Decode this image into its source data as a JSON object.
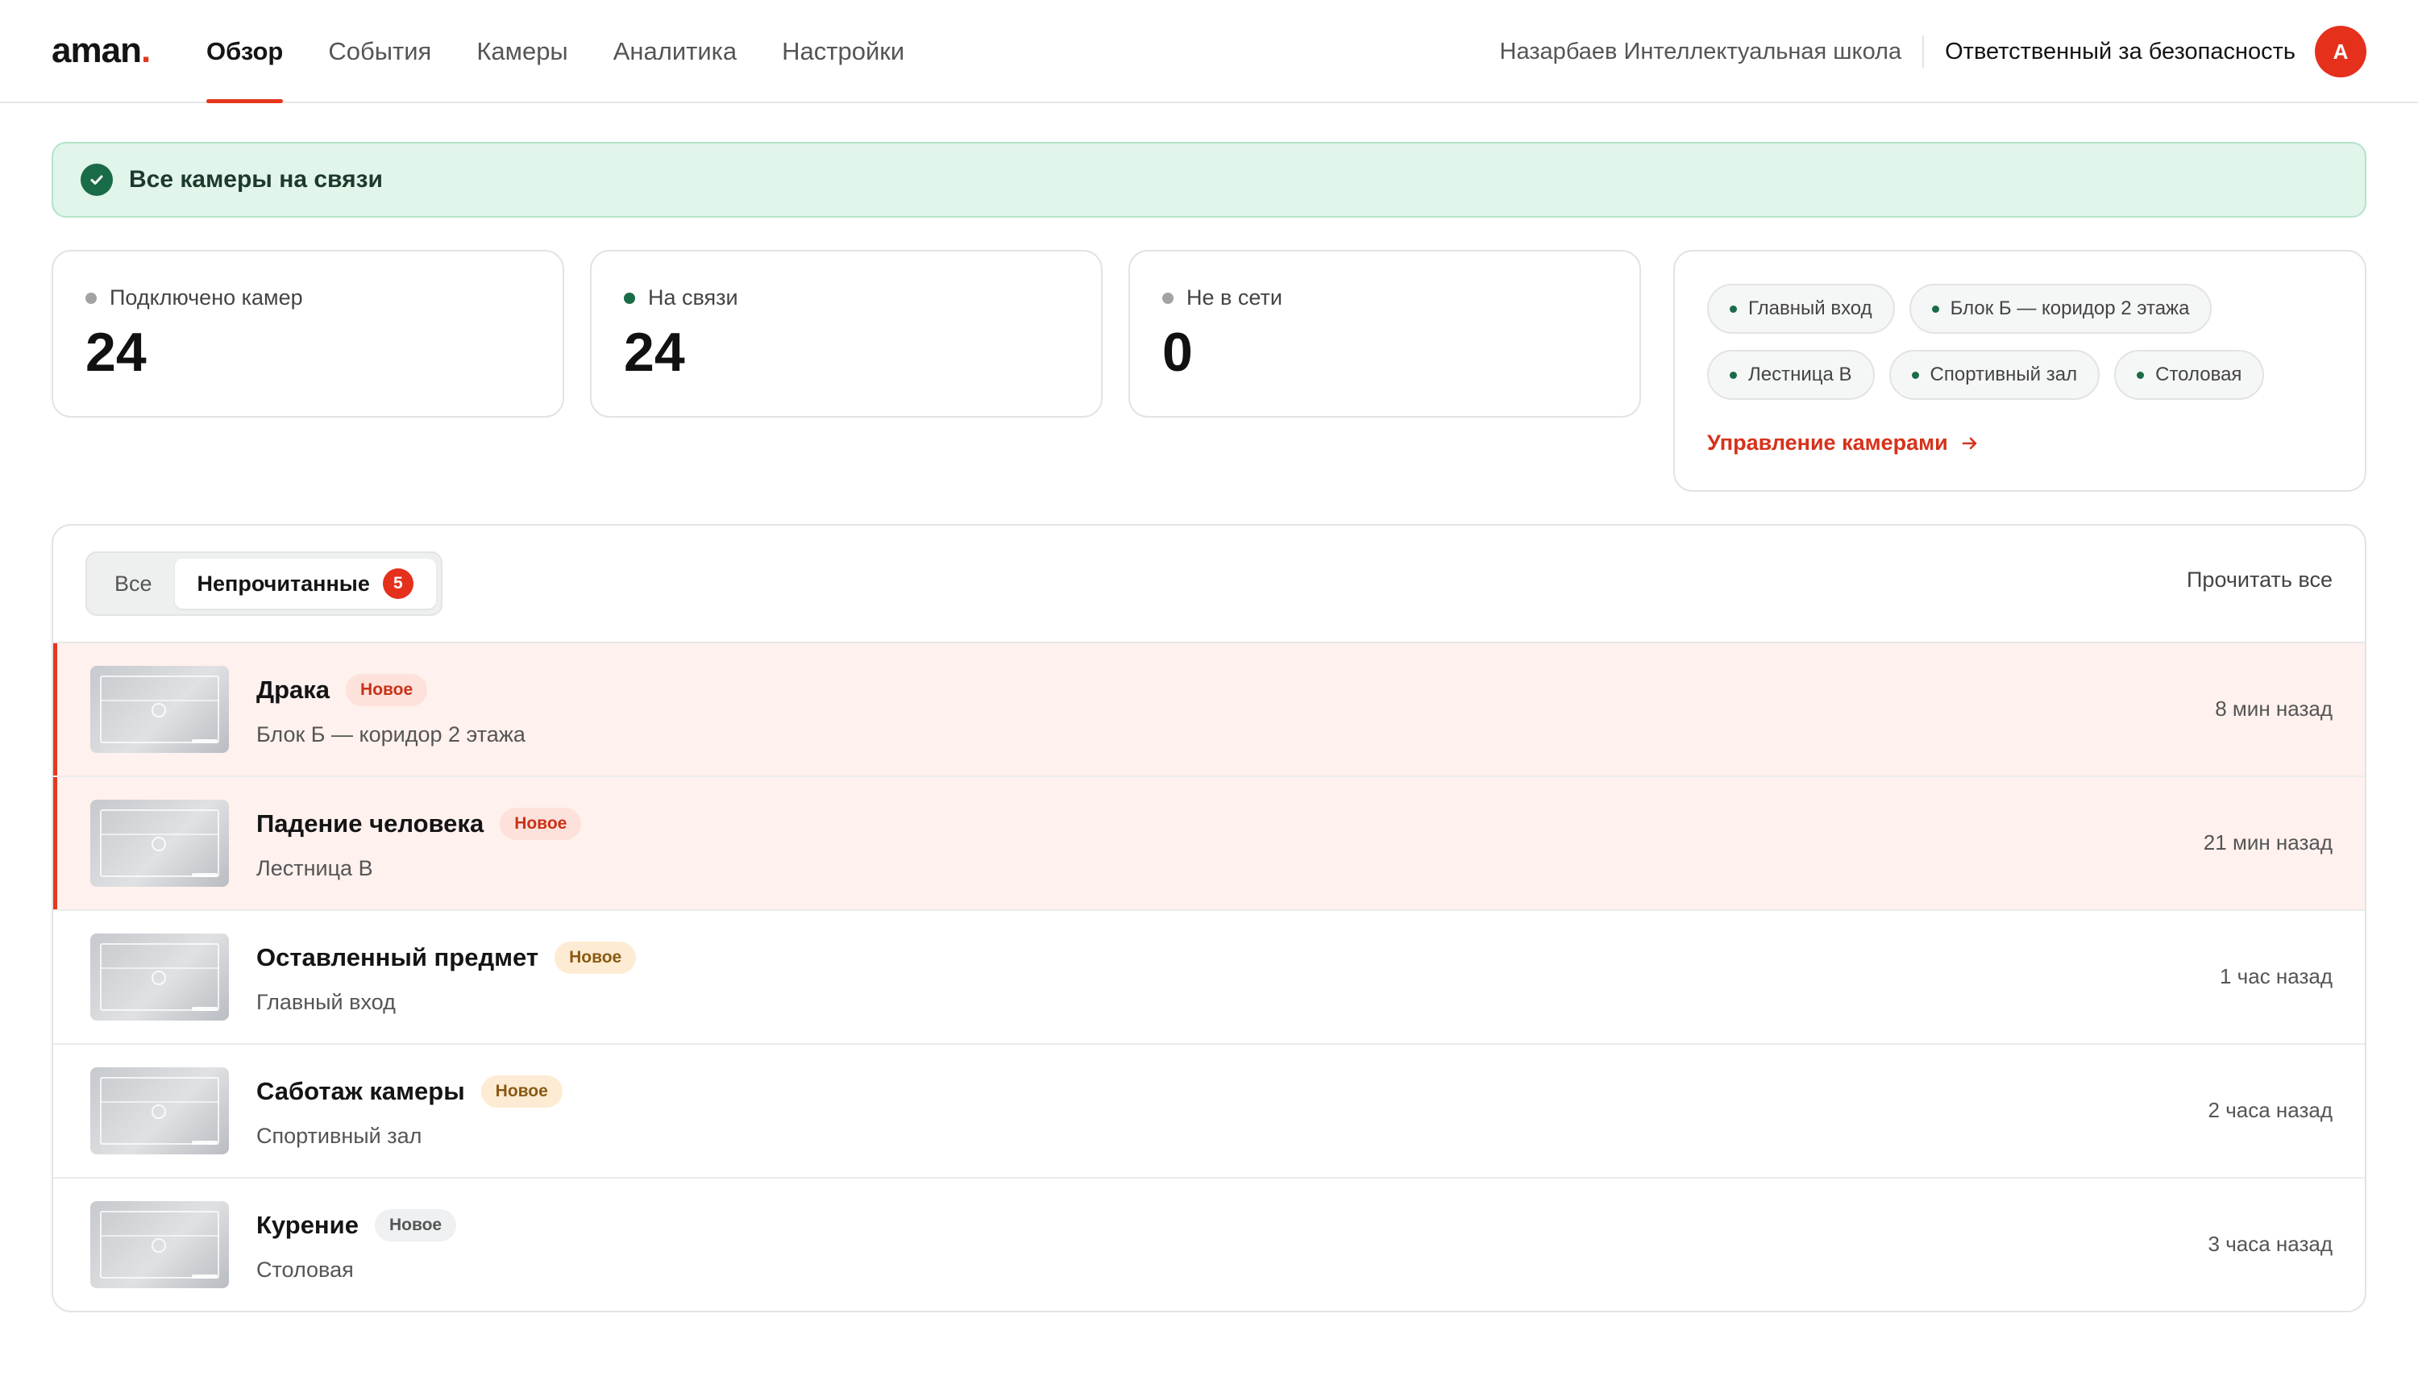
{
  "header": {
    "logo_text": "aman",
    "logo_dot": ".",
    "nav": [
      {
        "label": "Обзор"
      },
      {
        "label": "События"
      },
      {
        "label": "Камеры"
      },
      {
        "label": "Аналитика"
      },
      {
        "label": "Настройки"
      }
    ],
    "school": "Назарбаев Интеллектуальная школа",
    "role": "Ответственный за безопасность",
    "avatar_initial": "А"
  },
  "banner": {
    "text": "Все камеры на связи",
    "icon": "check-circle-icon"
  },
  "stats": [
    {
      "label": "Подключено камер",
      "value": "24",
      "dot_color": "#a3a3a3"
    },
    {
      "label": "На связи",
      "value": "24",
      "dot_color": "#1a6b47"
    },
    {
      "label": "Не в сети",
      "value": "0",
      "dot_color": "#a3a3a3"
    }
  ],
  "locations": {
    "chips": [
      "Главный вход",
      "Блок Б — коридор 2 этажа",
      "Лестница В",
      "Спортивный зал",
      "Столовая"
    ],
    "manage_label": "Управление камерами"
  },
  "events": {
    "tabs": {
      "all": "Все",
      "unread": "Непрочитанные",
      "unread_count": "5"
    },
    "read_all": "Прочитать все",
    "items": [
      {
        "title": "Драка",
        "badge": "Новое",
        "location": "Блок Б — коридор 2 этажа",
        "time": "8 мин назад"
      },
      {
        "title": "Падение человека",
        "badge": "Новое",
        "location": "Лестница В",
        "time": "21 мин назад"
      },
      {
        "title": "Оставленный предмет",
        "badge": "Новое",
        "location": "Главный вход",
        "time": "1 час назад"
      },
      {
        "title": "Саботаж камеры",
        "badge": "Новое",
        "location": "Спортивный зал",
        "time": "2 часа назад"
      },
      {
        "title": "Курение",
        "badge": "Новое",
        "location": "Столовая",
        "time": "3 часа назад"
      }
    ]
  },
  "colors": {
    "accent": "#e5381e",
    "success": "#1a6b47",
    "banner_bg": "#e1f5ea",
    "unread_row_bg": "#fef1ee"
  }
}
